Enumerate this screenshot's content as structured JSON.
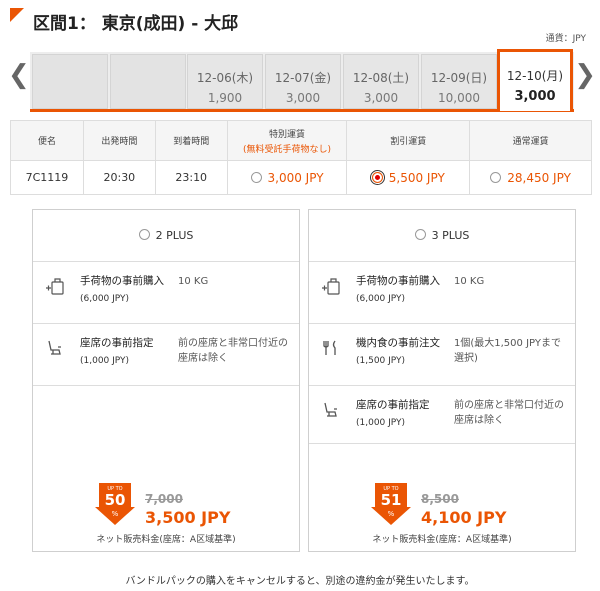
{
  "header": {
    "title": "区間1： 東京(成田) - 大邱",
    "currency": "通貨：JPY"
  },
  "dates": [
    {
      "label": "",
      "price": ""
    },
    {
      "label": "",
      "price": ""
    },
    {
      "label": "12-06(木)",
      "price": "1,900"
    },
    {
      "label": "12-07(金)",
      "price": "3,000"
    },
    {
      "label": "12-08(土)",
      "price": "3,000"
    },
    {
      "label": "12-09(日)",
      "price": "10,000"
    },
    {
      "label": "12-10(月)",
      "price": "3,000"
    }
  ],
  "nav": {
    "prev": "❮",
    "next": "❯"
  },
  "table": {
    "headers": [
      "便名",
      "出発時間",
      "到着時間",
      "特別運賃",
      "割引運賃",
      "通常運賃"
    ],
    "special_sub": "(無料受託手荷物なし)",
    "row": {
      "flight": "7C1119",
      "depart": "20:30",
      "arrive": "23:10",
      "special": "3,000 JPY",
      "discount": "5,500 JPY",
      "normal": "28,450 JPY"
    }
  },
  "bundles": [
    {
      "name": "2 PLUS",
      "items": [
        {
          "icon": "baggage-plus-icon",
          "name": "手荷物の事前購入",
          "price": "(6,000 JPY)",
          "value": "10 KG"
        },
        {
          "icon": "seat-icon",
          "name": "座席の事前指定",
          "price": "(1,000 JPY)",
          "value": "前の座席と非常口付近の座席は除く"
        }
      ],
      "badge_top": "UP TO",
      "badge_num": "50",
      "badge_pct": "%",
      "old_price": "7,000",
      "new_price": "3,500 JPY",
      "note": "ネット販売料金(座席：A区域基準)"
    },
    {
      "name": "3 PLUS",
      "items": [
        {
          "icon": "baggage-plus-icon",
          "name": "手荷物の事前購入",
          "price": "(6,000 JPY)",
          "value": "10 KG"
        },
        {
          "icon": "meal-icon",
          "name": "機内食の事前注文",
          "price": "(1,500 JPY)",
          "value": "1個(最大1,500 JPYまで選択)"
        },
        {
          "icon": "seat-icon",
          "name": "座席の事前指定",
          "price": "(1,000 JPY)",
          "value": "前の座席と非常口付近の座席は除く"
        }
      ],
      "badge_top": "UP TO",
      "badge_num": "51",
      "badge_pct": "%",
      "old_price": "8,500",
      "new_price": "4,100 JPY",
      "note": "ネット販売料金(座席：A区域基準)"
    }
  ],
  "footer": "バンドルパックの購入をキャンセルすると、別途の違約金が発生いたします。",
  "colors": {
    "accent": "#ea5504"
  }
}
